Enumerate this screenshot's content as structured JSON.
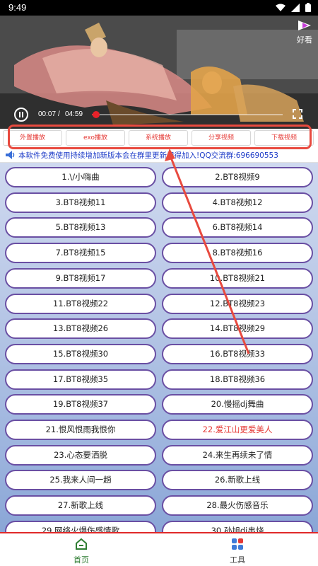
{
  "status_bar": {
    "time": "9:49"
  },
  "video": {
    "logo_text": "好看",
    "time_current": "00:07",
    "time_separator": "/",
    "time_total": "04:59",
    "progress_fraction": 0.023
  },
  "actions": [
    {
      "label": "外置播放"
    },
    {
      "label": "exo播放"
    },
    {
      "label": "系统播放"
    },
    {
      "label": "分享视频"
    },
    {
      "label": "下载视频"
    }
  ],
  "notice": {
    "text": "本软件免费使用持续增加新版本会在群里更新记得加入!QQ交流群:696690553"
  },
  "songs": [
    "1.\\/小嗨曲",
    "2.BT8视频9",
    "3.BT8视频11",
    "4.BT8视频12",
    "5.BT8视频13",
    "6.BT8视频14",
    "7.BT8视频15",
    "8.BT8视频16",
    "9.BT8视频17",
    "10.BT8视频21",
    "11.BT8视频22",
    "12.BT8视频23",
    "13.BT8视频26",
    "14.BT8视频29",
    "15.BT8视频30",
    "16.BT8视频33",
    "17.BT8视频35",
    "18.BT8视频36",
    "19.BT8视频37",
    "20.慢摇dj舞曲",
    "21.恨风恨雨我恨你",
    "22.爱江山更爱美人",
    "23.心态要洒脱",
    "24.来生再续未了情",
    "25.我来人间一趟",
    "26.新歌上线",
    "27.新歌上线",
    "28.最火伤感音乐",
    "29.网络火爆伤感情歌",
    "30.孙旭dj串烧"
  ],
  "active_song_index": 21,
  "nav": {
    "home": "首页",
    "tools": "工具"
  },
  "colors": {
    "accent_red": "#e53935",
    "button_border": "#6a4fa3",
    "home_green": "#2e7d32"
  }
}
